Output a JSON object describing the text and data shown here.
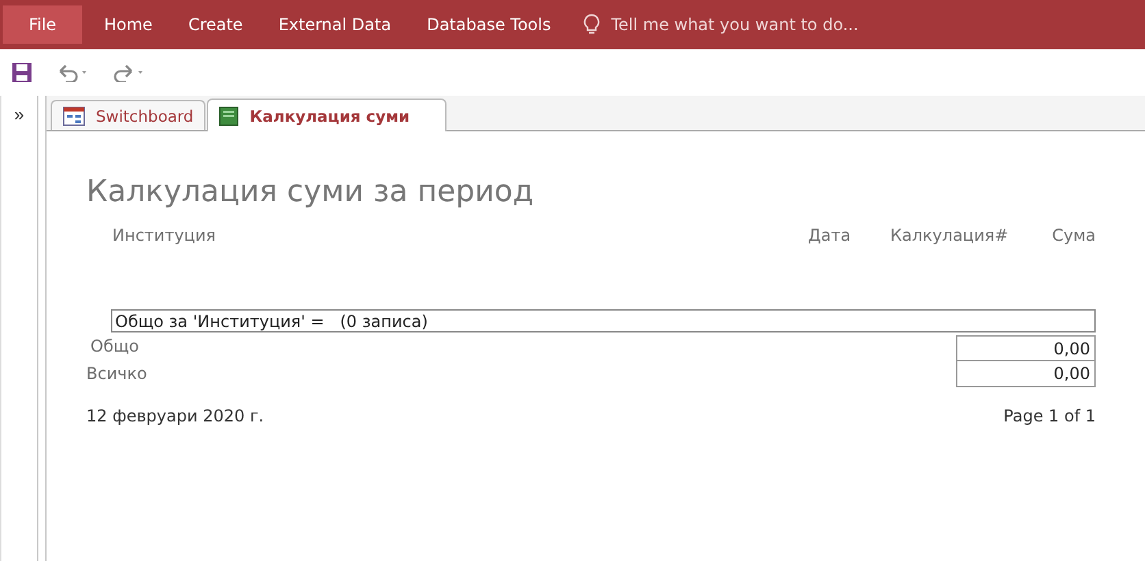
{
  "ribbon": {
    "tabs": [
      {
        "label": "File",
        "selected": true
      },
      {
        "label": "Home",
        "selected": false
      },
      {
        "label": "Create",
        "selected": false
      },
      {
        "label": "External Data",
        "selected": false
      },
      {
        "label": "Database Tools",
        "selected": false
      }
    ],
    "tell_me": {
      "placeholder": "Tell me what you want to do..."
    }
  },
  "nav_pane": {
    "toggle": "»"
  },
  "document_tabs": [
    {
      "label": "Switchboard",
      "kind": "form",
      "selected": false
    },
    {
      "label": "Калкулация суми",
      "kind": "report",
      "selected": true
    }
  ],
  "report": {
    "title": "Калкулация суми за период",
    "columns": [
      "Институция",
      "Дата",
      "Калкулация#",
      "Сума"
    ],
    "group_footer": "Общо за 'Институция' =   (0 записа)",
    "totals": [
      {
        "label": "Общо",
        "value": "0,00"
      },
      {
        "label": "Всичко",
        "value": "0,00"
      }
    ],
    "footer": {
      "date": "12 февруари 2020 г.",
      "page": "Page 1 of 1"
    }
  }
}
